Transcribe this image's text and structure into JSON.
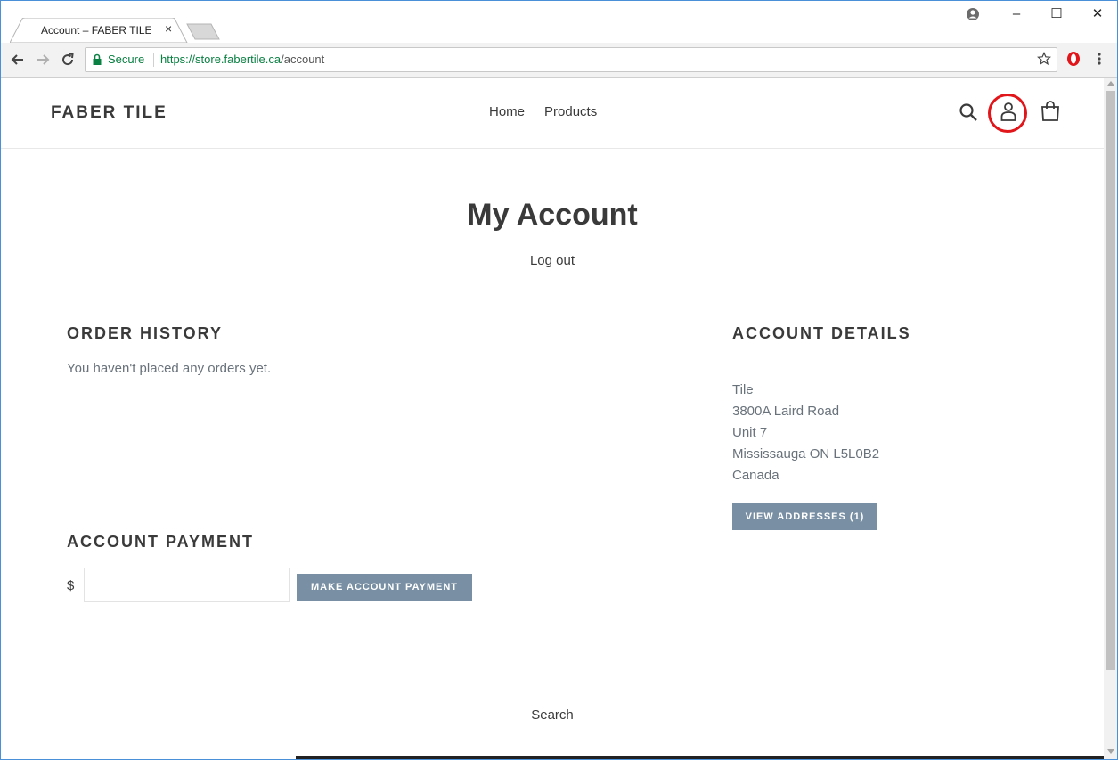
{
  "browser": {
    "tab_title": "Account – FABER TILE",
    "tab_close": "×",
    "secure_label": "Secure",
    "url_host": "https://store.fabertile.ca",
    "url_path": "/account",
    "window_controls": {
      "minimize": "–",
      "maximize": "☐",
      "close": "✕"
    }
  },
  "header": {
    "logo": "FABER TILE",
    "nav": [
      "Home",
      "Products"
    ]
  },
  "page": {
    "title": "My Account",
    "logout": "Log out"
  },
  "order_history": {
    "heading": "ORDER HISTORY",
    "empty_text": "You haven't placed any orders yet."
  },
  "account_details": {
    "heading": "ACCOUNT DETAILS",
    "address_lines": [
      "Tile",
      "3800A Laird Road",
      "Unit 7",
      "Mississauga ON L5L0B2",
      "Canada"
    ],
    "view_addresses_label": "VIEW ADDRESSES (1)"
  },
  "account_payment": {
    "heading": "ACCOUNT PAYMENT",
    "currency": "$",
    "amount_value": "",
    "button_label": "MAKE ACCOUNT PAYMENT"
  },
  "footer": {
    "search_link": "Search"
  },
  "colors": {
    "button_bg": "#788fa4",
    "text_dark": "#3a3a3a",
    "text_muted": "#69727b",
    "annotation": "#e0161b",
    "secure_green": "#0b8043"
  }
}
